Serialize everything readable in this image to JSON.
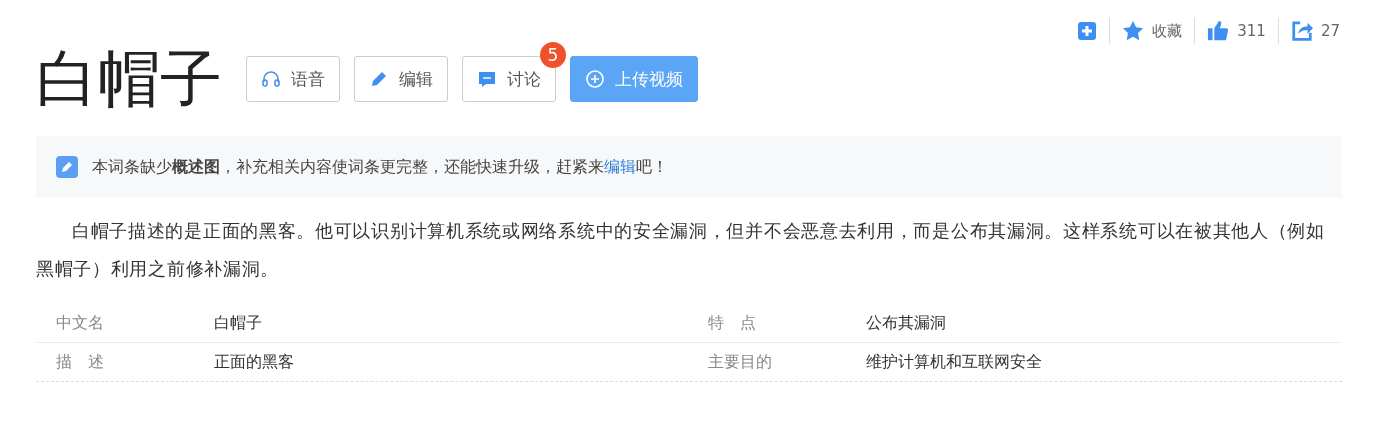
{
  "title": "白帽子",
  "actions": [
    {
      "kind": "audio",
      "label": "语音"
    },
    {
      "kind": "edit",
      "label": "编辑"
    },
    {
      "kind": "discuss",
      "label": "讨论",
      "badge": "5"
    },
    {
      "kind": "upload",
      "label": "上传视频"
    }
  ],
  "toolbar": [
    {
      "kind": "add"
    },
    {
      "kind": "star",
      "label": "收藏"
    },
    {
      "kind": "like",
      "label": "311"
    },
    {
      "kind": "share",
      "label": "27"
    }
  ],
  "notice": {
    "before": "本词条缺少**概述图**，补充相关内容使词条更完整，还能快速升级，赶紧来",
    "link": "编辑",
    "after": "吧！"
  },
  "summary": "白帽子描述的是正面的黑客。他可以识别计算机系统或网络系统中的安全漏洞，但并不会恶意去利用，而是公布其漏洞。这样系统可以在被其他人（例如黑帽子）利用之前修补漏洞。",
  "info": [
    [
      {
        "name": "中文名",
        "value": "白帽子"
      },
      {
        "name": "特　点",
        "value": "公布其漏洞"
      }
    ],
    [
      {
        "name": "描　述",
        "value": "正面的黑客"
      },
      {
        "name": "主要目的",
        "value": "维护计算机和互联网安全"
      }
    ]
  ]
}
